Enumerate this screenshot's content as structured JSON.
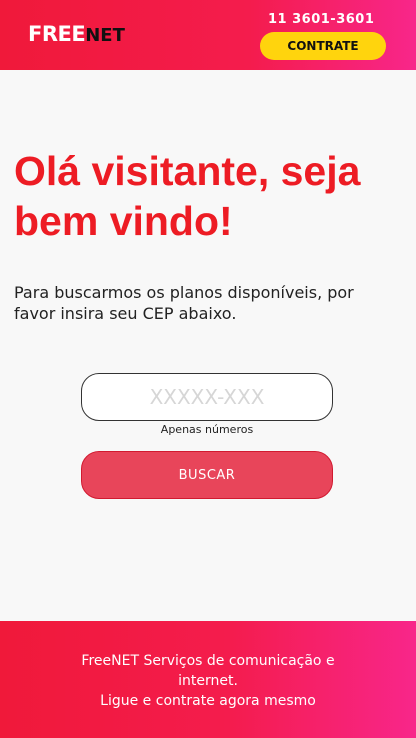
{
  "header": {
    "logo": {
      "part1": "FREE",
      "part2": "NET"
    },
    "phone": "11 3601-3601",
    "cta_label": "CONTRATE"
  },
  "main": {
    "title_line1": "Olá visitante, seja",
    "title_line2": "bem vindo!",
    "subtitle_line1": "Para buscarmos os planos disponíveis, por",
    "subtitle_line2": "favor insira seu CEP abaixo.",
    "cep": {
      "placeholder": "XXXXX-XXX",
      "value": "",
      "hint": "Apenas números"
    },
    "search_label": "BUSCAR"
  },
  "footer": {
    "line1": "FreeNET Serviços de comunicação e",
    "line2": "internet.",
    "line3": "Ligue e contrate agora mesmo"
  },
  "colors": {
    "brand_red": "#ed1c24",
    "brand_pink": "#f8268a",
    "cta_yellow": "#ffd40d",
    "button_red": "#e8455a"
  }
}
